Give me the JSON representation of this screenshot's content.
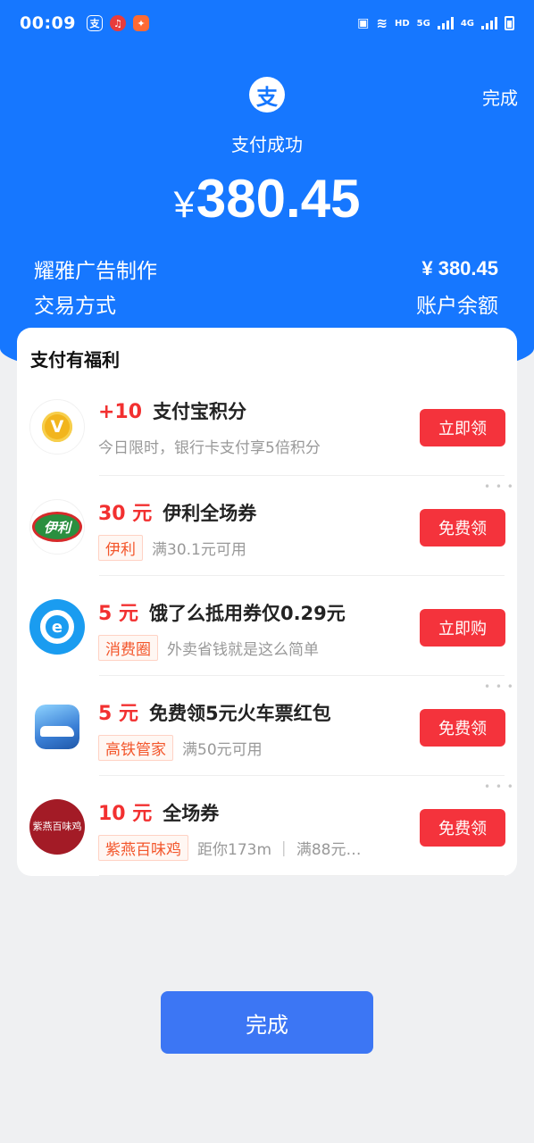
{
  "status_bar": {
    "time": "00:09",
    "network_label": "HD",
    "net1": "5G",
    "net2": "4G"
  },
  "header": {
    "done_label": "完成",
    "logo_char": "支",
    "status_text": "支付成功",
    "currency_symbol": "¥",
    "amount": "380.45"
  },
  "details": {
    "merchant": "耀雅广告制作",
    "merchant_amount": "¥ 380.45",
    "method_label": "交易方式",
    "method_value": "账户余额"
  },
  "benefits": {
    "title": "支付有福利",
    "items": [
      {
        "amount": "+10",
        "name": "支付宝积分",
        "tag": "",
        "desc": "今日限时，银行卡支付享5倍积分",
        "button": "立即领",
        "icon": "points-coin-icon"
      },
      {
        "amount": "30 元",
        "name": "伊利全场券",
        "tag": "伊利",
        "desc": "满30.1元可用",
        "button": "免费领",
        "icon": "yili-logo-icon"
      },
      {
        "amount": "5 元",
        "name": "饿了么抵用券仅0.29元",
        "tag": "消费圈",
        "desc": "外卖省钱就是这么简单",
        "button": "立即购",
        "icon": "eleme-logo-icon"
      },
      {
        "amount": "5 元",
        "name": "免费领5元火车票红包",
        "tag": "高铁管家",
        "desc": "满50元可用",
        "button": "免费领",
        "icon": "train-app-icon"
      },
      {
        "amount": "10 元",
        "name": "全场券",
        "tag": "紫燕百味鸡",
        "desc": "距你173m ｜ 满88元…",
        "button": "免费领",
        "icon": "ziyan-logo-icon"
      }
    ]
  },
  "icon_text": {
    "points": "V",
    "yili": "伊利",
    "eleme": "e",
    "chicken": "紫燕百味鸡"
  },
  "bottom": {
    "done_label": "完成"
  },
  "colors": {
    "brand_blue": "#1677ff",
    "button_red": "#f4333c",
    "amount_red": "#f23030",
    "done_blue": "#3c76f4"
  }
}
